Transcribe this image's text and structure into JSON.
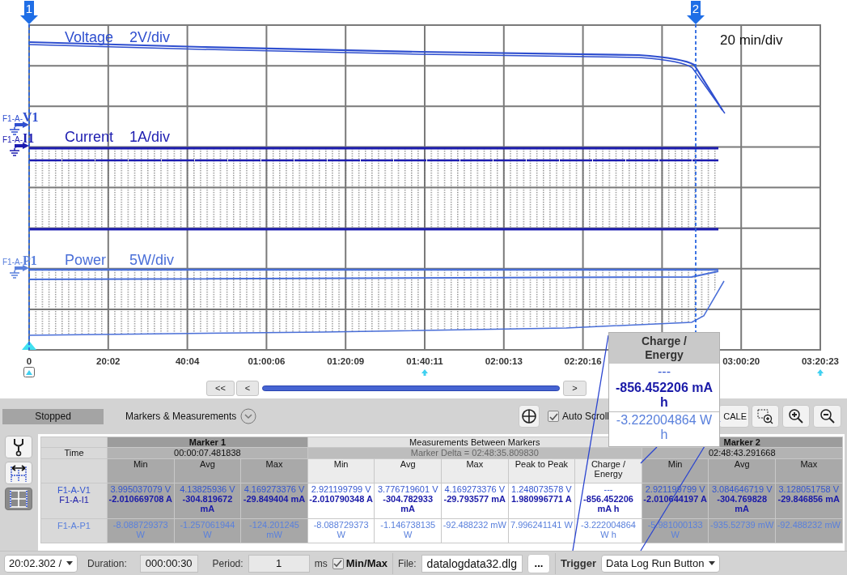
{
  "plot": {
    "traces": [
      {
        "kind": "voltage",
        "name": "Voltage",
        "scale": "2V/div",
        "color": "#2f4fcf"
      },
      {
        "kind": "current",
        "name": "Current",
        "scale": "1A/div",
        "color": "#1c1cb0"
      },
      {
        "kind": "power",
        "name": "Power",
        "scale": "5W/div",
        "color": "#4a6fd8"
      }
    ],
    "channel_tags": [
      {
        "text": "F1-A-**V1**",
        "color": "#3050d0"
      },
      {
        "text": "F1-A-**I1**",
        "color": "#1c1cb0"
      },
      {
        "text": "F1-A-**P1**",
        "color": "#5a80dc"
      }
    ],
    "time_scale": "20 min/div",
    "time_ticks": [
      "0",
      "20:02",
      "40:04",
      "01:00:06",
      "01:20:09",
      "01:40:11",
      "02:00:13",
      "02:20:16",
      "03:00:20",
      "03:20:23"
    ],
    "markers": [
      "1",
      "2"
    ]
  },
  "scrollbar": {
    "buttons": [
      "<<",
      "<",
      ">"
    ]
  },
  "toolbar": {
    "status": "Stopped",
    "title": "Markers & Measurements",
    "auto_scroll": {
      "label": "Auto Scroll",
      "checked": true
    },
    "autoscale": "CALE"
  },
  "side_tools": [
    {
      "kind": "probe",
      "selected": false
    },
    {
      "kind": "span",
      "selected": false
    },
    {
      "kind": "grid",
      "selected": true
    }
  ],
  "table": {
    "time_label": "Time",
    "groups": [
      {
        "kind": "marker",
        "title": "Marker 1",
        "time": "00:00:07.481838",
        "columns": [
          "Min",
          "Avg",
          "Max"
        ]
      },
      {
        "kind": "between",
        "title": "Measurements Between Markers",
        "time": "Marker Delta = 02:48:35.809830",
        "columns": [
          "Min",
          "Avg",
          "Max",
          "Peak to Peak",
          "Charge / Energy"
        ]
      },
      {
        "kind": "marker",
        "title": "Marker 2",
        "time": "02:48:43.291668",
        "columns": [
          "Min",
          "Avg",
          "Max"
        ]
      }
    ],
    "rows": [
      {
        "lines": [
          {
            "channel": "F1-A-V1",
            "color": "#3355d0",
            "selected": false,
            "cells": [
              "3.995037079 V",
              "4.13825936 V",
              "4.169273376 V",
              "2.921199799 V",
              "3.776719601 V",
              "4.169273376 V",
              "1.248073578 V",
              "---",
              "2.921199799 V",
              "3.084646719 V",
              "3.128051758 V"
            ]
          },
          {
            "channel": "F1-A-I1",
            "color": "#1a1aa8",
            "selected": true,
            "cells": [
              "-2.010669708 A",
              "-304.819672 mA",
              "-29.849404 mA",
              "-2.010790348 A",
              "-304.782933 mA",
              "-29.793577 mA",
              "1.980996771 A",
              "-856.452206 mA h",
              "-2.010644197 A",
              "-304.769828 mA",
              "-29.846856 mA"
            ]
          }
        ]
      },
      {
        "lines": [
          {
            "channel": "F1-A-P1",
            "color": "#5a80dc",
            "selected": false,
            "cells": [
              "-8.088729373 W",
              "-1.257061944 W",
              "-124.201245 mW",
              "-8.088729373 W",
              "-1.146738135 W",
              "-92.488232 mW",
              "7.996241141 W",
              "-3.222004864 W h",
              "-5.981000133 W",
              "-935.52739 mW",
              "-92.488232 mW"
            ]
          }
        ]
      }
    ]
  },
  "callout": {
    "title": "Charge / Energy",
    "lines": [
      {
        "text": "---",
        "color": "#3355d0",
        "selected": false
      },
      {
        "text": "-856.452206 mA h",
        "color": "#1a1aa8",
        "selected": true
      },
      {
        "text": "-3.222004864 W h",
        "color": "#5a80dc",
        "selected": false
      }
    ]
  },
  "bottom_bar": {
    "time_select": "20:02.302 /",
    "duration_label": "Duration:",
    "duration": "000:00:30",
    "period_label": "Period:",
    "period": "1",
    "period_unit": "ms",
    "minmax": {
      "label": "Min/Max",
      "checked": true
    },
    "file_label": "File:",
    "file": "datalogdata32.dlg",
    "browse": "...",
    "trigger_label": "Trigger",
    "trigger": "Data Log Run Button"
  }
}
